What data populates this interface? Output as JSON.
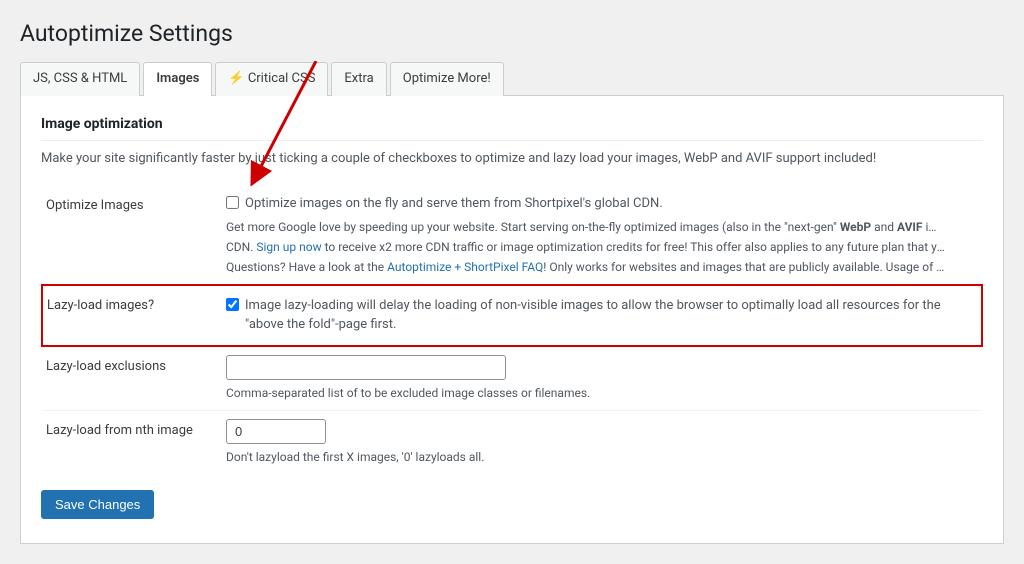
{
  "page": {
    "title": "Autoptimize Settings"
  },
  "tabs": [
    {
      "id": "js-css-html",
      "label": "JS, CSS & HTML",
      "active": false
    },
    {
      "id": "images",
      "label": "Images",
      "active": true
    },
    {
      "id": "critical-css",
      "label": "⚡ Critical CSS",
      "active": false,
      "lightning": true
    },
    {
      "id": "extra",
      "label": "Extra",
      "active": false
    },
    {
      "id": "optimize-more",
      "label": "Optimize More!",
      "active": false
    }
  ],
  "section": {
    "title": "Image optimization",
    "description": "Make your site significantly faster by just ticking a couple of checkboxes to optimize and lazy load your images, WebP and AVIF support included!"
  },
  "fields": [
    {
      "id": "optimize-images",
      "label": "Optimize Images",
      "type": "checkbox",
      "checked": false,
      "description": "Optimize images on the fly and serve them from Shortpixel's global CDN.",
      "extra_text": "Get more Google love by speeding up your website. Start serving on-the-fly optimized images (also in the \"next-gen\" WebP and AVIF image formats) by ShortPixel CDN. Sign up now to receive x2 more CDN traffic or image optimization credits for free! This offer also applies to any future plan that you'll choose to purchase.",
      "questions_text": "Questions? Have a look at the Autoptimize + ShortPixel FAQ! Only works for websites and images that are publicly available. Usage of this feature is subject to S",
      "link_text": "ShortPixel CDN",
      "link2_text": "Autoptimize + ShortPixel FAQ",
      "highlighted": false
    },
    {
      "id": "lazy-load-images",
      "label": "Lazy-load images?",
      "type": "checkbox",
      "checked": true,
      "description": "Image lazy-loading will delay the loading of non-visible images to allow the browser to optimally load all resources for the \"above the fold\"-page first.",
      "highlighted": true
    },
    {
      "id": "lazy-load-exclusions",
      "label": "Lazy-load exclusions",
      "type": "text",
      "value": "",
      "placeholder": "",
      "note": "Comma-separated list of to be excluded image classes or filenames.",
      "highlighted": false
    },
    {
      "id": "lazy-load-nth",
      "label": "Lazy-load from nth image",
      "type": "text",
      "value": "0",
      "placeholder": "",
      "note": "Don't lazyload the first X images, '0' lazyloads all.",
      "highlighted": false
    }
  ],
  "buttons": {
    "save_label": "Save Changes"
  }
}
